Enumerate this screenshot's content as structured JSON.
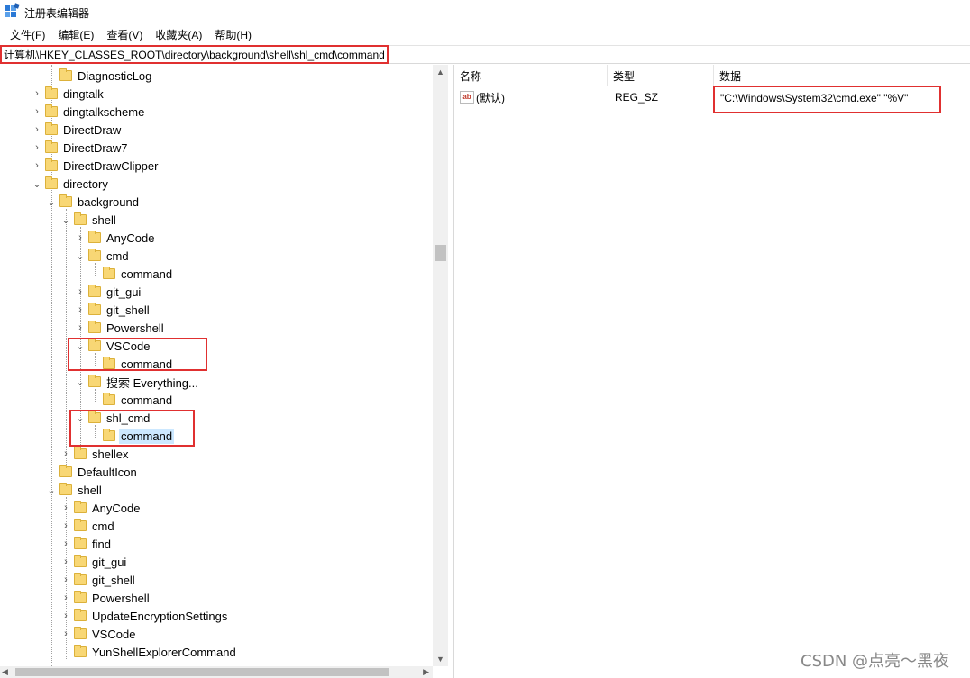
{
  "window": {
    "title": "注册表编辑器",
    "icon": "registry-editor-icon"
  },
  "menu": [
    {
      "label": "文件(F)"
    },
    {
      "label": "编辑(E)"
    },
    {
      "label": "查看(V)"
    },
    {
      "label": "收藏夹(A)"
    },
    {
      "label": "帮助(H)"
    }
  ],
  "address": {
    "path": "计算机\\HKEY_CLASSES_ROOT\\directory\\background\\shell\\shl_cmd\\command"
  },
  "tree": [
    {
      "label": "DiagnosticLog",
      "expander": ""
    },
    {
      "label": "dingtalk",
      "expander": ">"
    },
    {
      "label": "dingtalkscheme",
      "expander": ">"
    },
    {
      "label": "DirectDraw",
      "expander": ">"
    },
    {
      "label": "DirectDraw7",
      "expander": ">"
    },
    {
      "label": "DirectDrawClipper",
      "expander": ">"
    },
    {
      "label": "directory",
      "expander": "v"
    },
    {
      "label": "background",
      "expander": "v"
    },
    {
      "label": "shell",
      "expander": "v"
    },
    {
      "label": "AnyCode",
      "expander": ">"
    },
    {
      "label": "cmd",
      "expander": "v"
    },
    {
      "label": "command",
      "expander": ""
    },
    {
      "label": "git_gui",
      "expander": ">"
    },
    {
      "label": "git_shell",
      "expander": ">"
    },
    {
      "label": "Powershell",
      "expander": ">"
    },
    {
      "label": "VSCode",
      "expander": "v"
    },
    {
      "label": "command",
      "expander": ""
    },
    {
      "label": "搜索 Everything...",
      "expander": "v"
    },
    {
      "label": "command",
      "expander": ""
    },
    {
      "label": "shl_cmd",
      "expander": "v"
    },
    {
      "label": "command",
      "expander": "",
      "selected": true
    },
    {
      "label": "shellex",
      "expander": ">"
    },
    {
      "label": "DefaultIcon",
      "expander": ""
    },
    {
      "label": "shell",
      "expander": "v"
    },
    {
      "label": "AnyCode",
      "expander": ">"
    },
    {
      "label": "cmd",
      "expander": ">"
    },
    {
      "label": "find",
      "expander": ">"
    },
    {
      "label": "git_gui",
      "expander": ">"
    },
    {
      "label": "git_shell",
      "expander": ">"
    },
    {
      "label": "Powershell",
      "expander": ">"
    },
    {
      "label": "UpdateEncryptionSettings",
      "expander": ">"
    },
    {
      "label": "VSCode",
      "expander": ">"
    },
    {
      "label": "YunShellExplorerCommand",
      "expander": ""
    }
  ],
  "list": {
    "columns": [
      "名称",
      "类型",
      "数据"
    ],
    "rows": [
      {
        "name": "(默认)",
        "type": "REG_SZ",
        "data": "\"C:\\Windows\\System32\\cmd.exe\" \"%V\"",
        "icon": "ab"
      }
    ]
  },
  "watermark": "CSDN @点亮～黑夜",
  "colors": {
    "highlight": "#e03030",
    "selection": "#cce8ff",
    "folder": "#f8d775"
  }
}
